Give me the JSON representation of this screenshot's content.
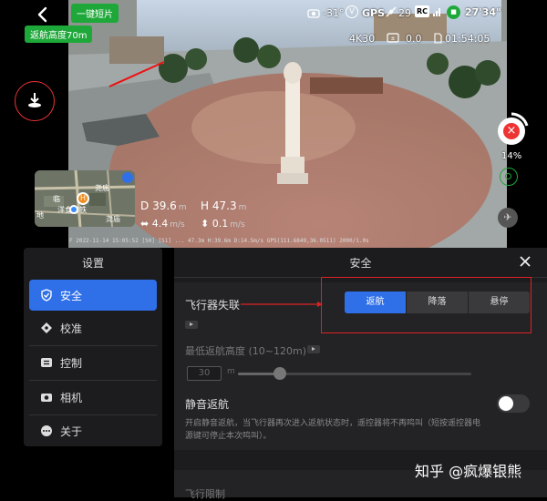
{
  "hud": {
    "quick_shot_label": "一键短片",
    "rth_altitude_label": "返航高度70m",
    "gimbal_angle": "-31°",
    "gps_label": "GPS",
    "satellite_count": "29",
    "rc_label": "RC",
    "flight_time": "27'34\"",
    "video_mode": "4K30",
    "ev_value": "0.0",
    "record_time": "01:54:05",
    "battery_percent": "14%",
    "telemetry": {
      "d_label": "D",
      "d_value": "39.6",
      "d_unit": "m",
      "h_label": "H",
      "h_value": "47.3",
      "h_unit": "m",
      "hs_value": "4.4",
      "hs_unit": "m/s",
      "vs_value": "0.1",
      "vs_unit": "m/s"
    },
    "map_labels": [
      "临",
      "尧庙",
      "洋食泉铁",
      "尧庙",
      "地"
    ],
    "caption": "F 2022-11-14 15:05:52 [S0] [S1] ... 47.3m H:39.6m D:14.5m/s GPS(111.6849,36.0511) 2000/1.0s"
  },
  "settings_sidebar": {
    "title": "设置",
    "items": [
      {
        "label": "安全",
        "icon": "shield-icon",
        "active": true
      },
      {
        "label": "校准",
        "icon": "compass-icon",
        "active": false
      },
      {
        "label": "控制",
        "icon": "controller-icon",
        "active": false
      },
      {
        "label": "相机",
        "icon": "camera-icon",
        "active": false
      },
      {
        "label": "关于",
        "icon": "more-icon",
        "active": false
      }
    ]
  },
  "safety_panel": {
    "title": "安全",
    "signal_lost_label": "飞行器失联",
    "signal_lost_options": [
      "返航",
      "降落",
      "悬停"
    ],
    "selected_option": "返航",
    "min_rth_label": "最低返航高度 (10~120m)",
    "min_rth_value": "30",
    "min_rth_unit": "m",
    "min_rth_fraction": 0.18,
    "silent_rth_label": "静音返航",
    "silent_rth_enabled": false,
    "silent_rth_desc": "开启静音返航，当飞行器再次进入返航状态时，遥控器将不再鸣叫（短按遥控器电源键可停止本次鸣叫）。",
    "next_section_label": "飞行限制"
  },
  "watermark": "知乎 @疯爆银熊",
  "colors": {
    "accent": "#2f6fe8",
    "annotation_red": "#dd2222",
    "badge_green": "#1fa83a"
  }
}
